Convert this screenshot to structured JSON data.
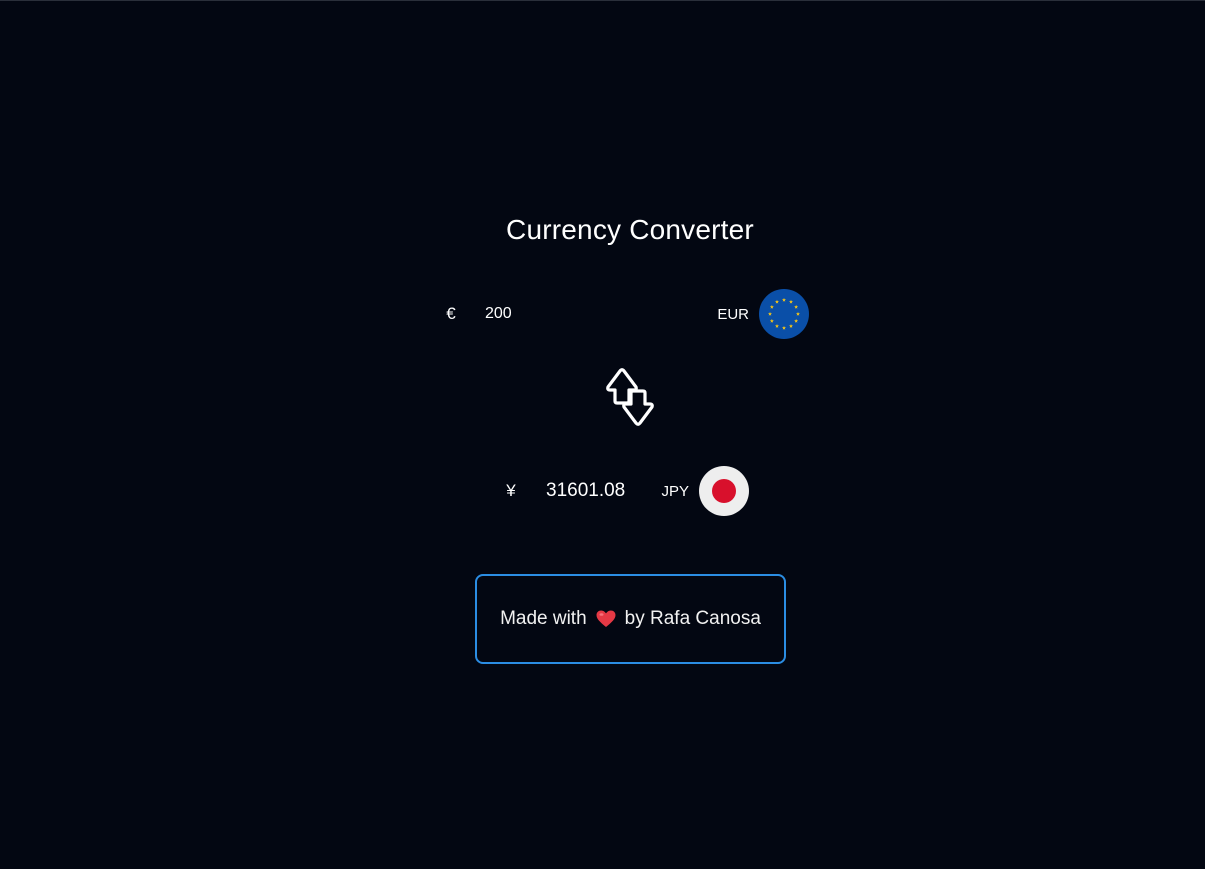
{
  "title": "Currency Converter",
  "from": {
    "symbol": "€",
    "amount": "200",
    "code": "EUR",
    "flag_icon": "eu-flag-icon"
  },
  "to": {
    "symbol": "¥",
    "amount": "31601.08",
    "code": "JPY",
    "flag_icon": "jp-flag-icon"
  },
  "swap_icon": "swap-arrows-icon",
  "credit": {
    "prefix": "Made with",
    "heart_icon": "heart-icon",
    "suffix": "by Rafa Canosa"
  },
  "colors": {
    "background": "#030712",
    "accent_border": "#2b8de3",
    "eu_blue": "#0a4fa8",
    "eu_star": "#f5c518",
    "jp_red": "#d8102c",
    "heart_red": "#e53945"
  }
}
